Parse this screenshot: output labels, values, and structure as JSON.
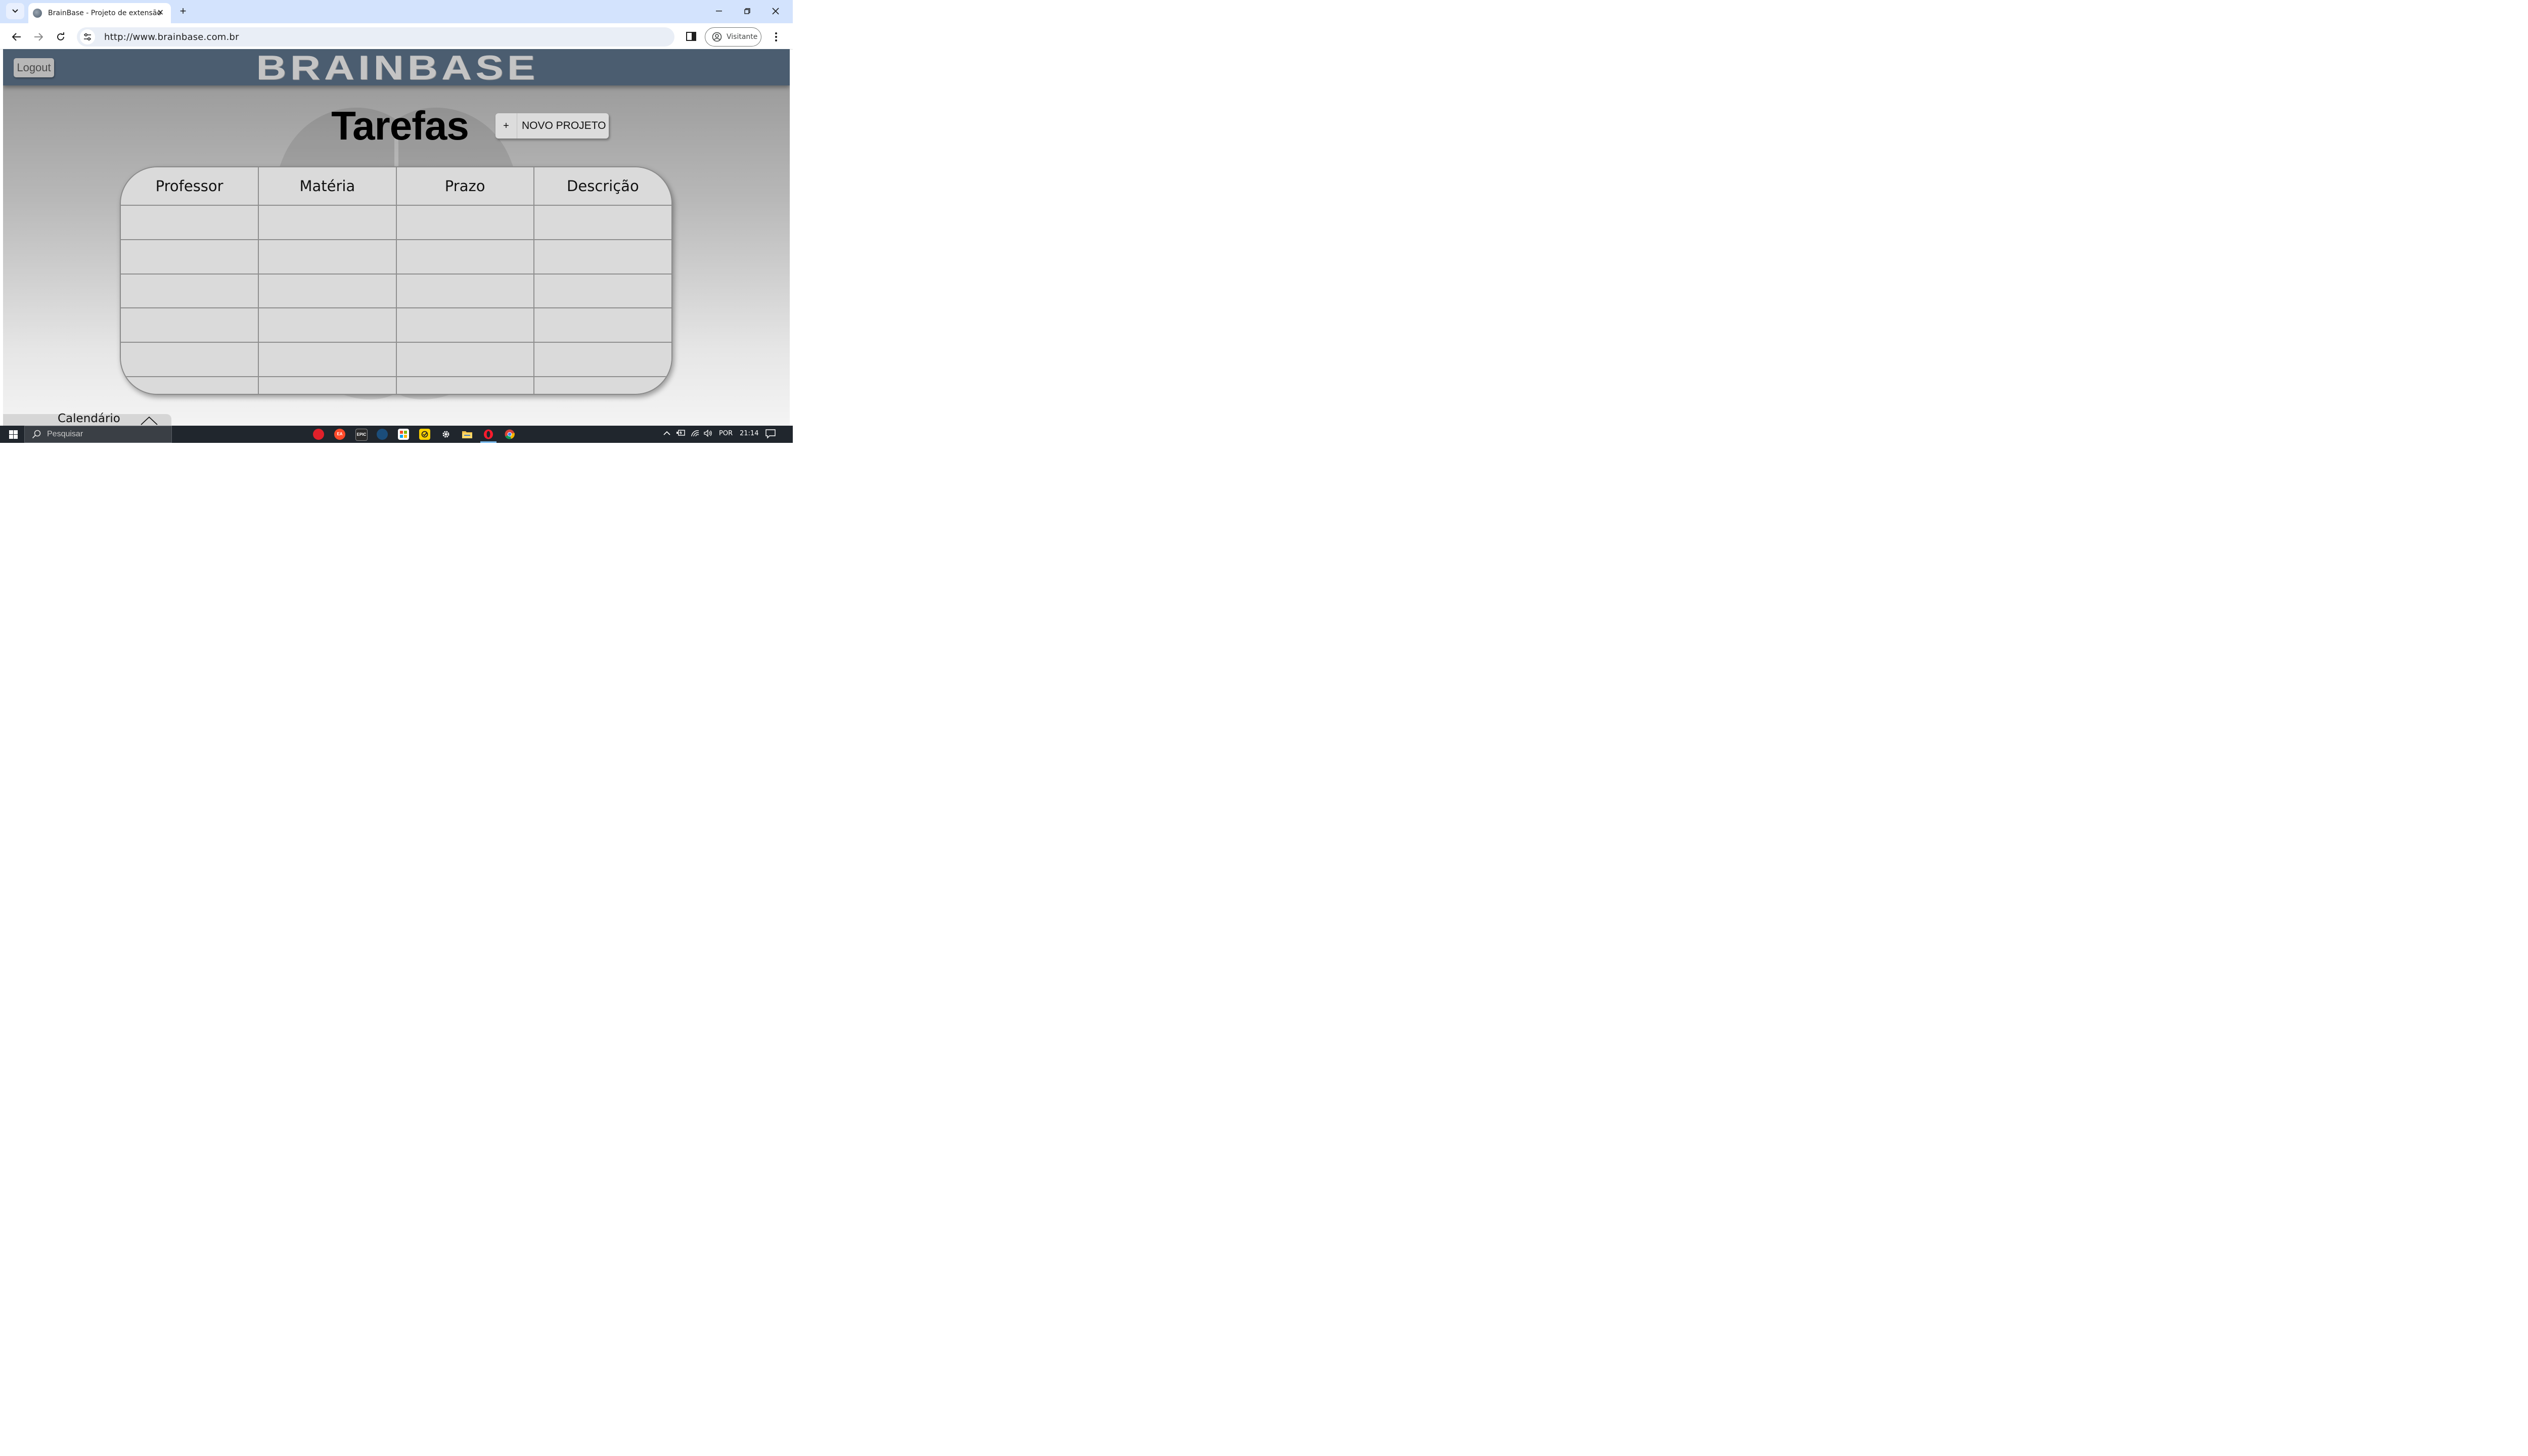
{
  "browser": {
    "tab_title": "BrainBase - Projeto de extensão",
    "url": "http://www.brainbase.com.br",
    "profile_label": "Visitante"
  },
  "header": {
    "logout_label": "Logout",
    "logo_text": "BRAINBASE"
  },
  "main": {
    "title": "Tarefas",
    "new_project": {
      "icon": "+",
      "label": "NOVO PROJETO"
    },
    "table": {
      "columns": [
        "Professor",
        "Matéria",
        "Prazo",
        "Descrição"
      ],
      "rows": [
        [
          "",
          "",
          "",
          ""
        ],
        [
          "",
          "",
          "",
          ""
        ],
        [
          "",
          "",
          "",
          ""
        ],
        [
          "",
          "",
          "",
          ""
        ],
        [
          "",
          "",
          "",
          ""
        ],
        [
          "",
          "",
          "",
          ""
        ]
      ]
    },
    "calendar_label": "Calendário"
  },
  "taskbar": {
    "search_placeholder": "Pesquisar",
    "language": "POR",
    "time": "21:14",
    "apps": [
      "roblox-icon",
      "ea-icon",
      "epic-games-icon",
      "steam-icon",
      "microsoft-store-icon",
      "norton-icon",
      "settings-icon",
      "file-explorer-icon",
      "opera-icon",
      "chrome-icon"
    ]
  },
  "colors": {
    "header_bg": "#4b5d70",
    "chrome_tab_strip": "#d3e3fd",
    "table_cell": "#dadada",
    "taskbar_bg": "#20262d"
  }
}
